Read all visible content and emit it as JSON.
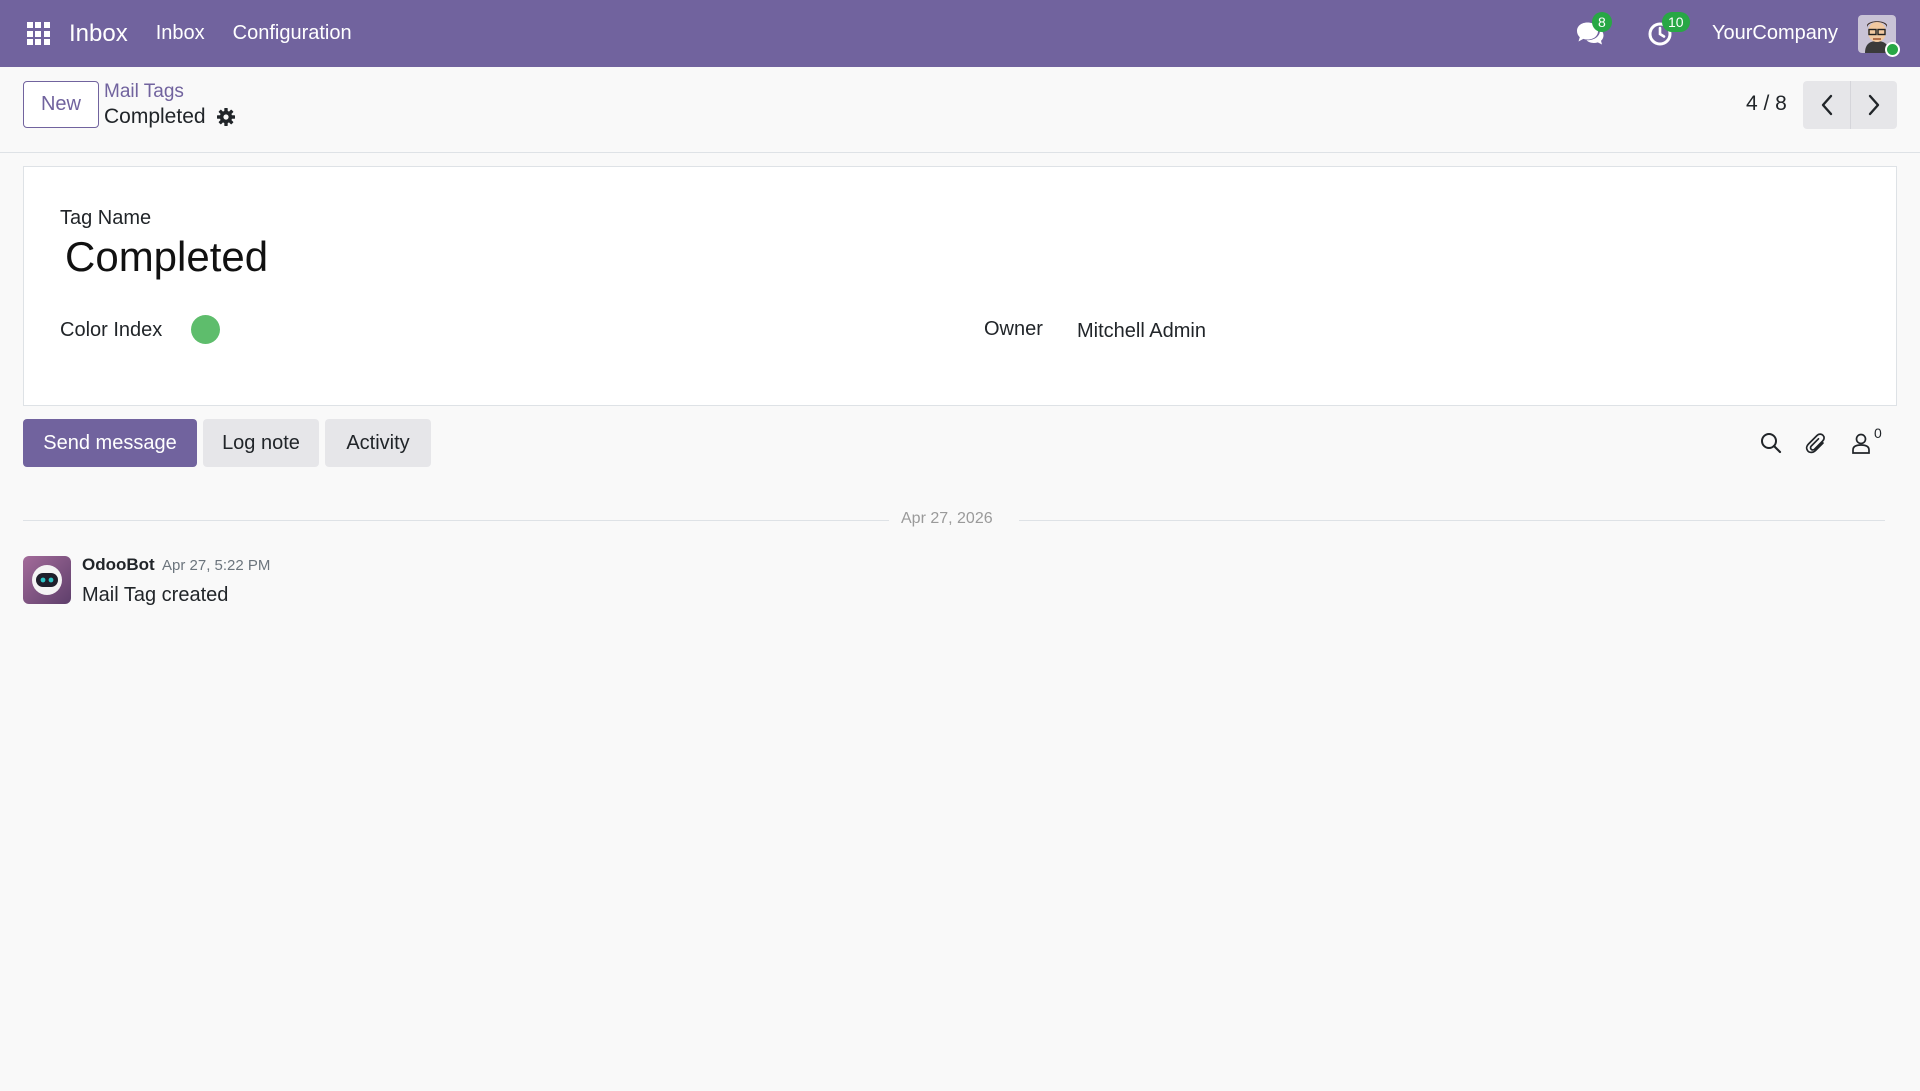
{
  "navbar": {
    "app_name": "Inbox",
    "menu": [
      "Inbox",
      "Configuration"
    ],
    "messages_badge": "8",
    "activities_badge": "10",
    "company": "YourCompany"
  },
  "control": {
    "new_label": "New",
    "breadcrumb_parent": "Mail Tags",
    "breadcrumb_current": "Completed",
    "pager_value": "4 / 8"
  },
  "form": {
    "tag_name_label": "Tag Name",
    "tag_name_value": "Completed",
    "color_index_label": "Color Index",
    "color_index_color": "#5ebd6c",
    "owner_label": "Owner",
    "owner_value": "Mitchell Admin"
  },
  "chatter": {
    "send_message_label": "Send message",
    "log_note_label": "Log note",
    "activity_label": "Activity",
    "followers_count": "0",
    "date_separator": "Apr 27, 2026",
    "messages": [
      {
        "author": "OdooBot",
        "date": "Apr 27, 5:22 PM",
        "body": "Mail Tag created"
      }
    ]
  },
  "colors": {
    "brand": "#71639e",
    "badge": "#28a745",
    "secondary_button": "#e6e6e9"
  }
}
